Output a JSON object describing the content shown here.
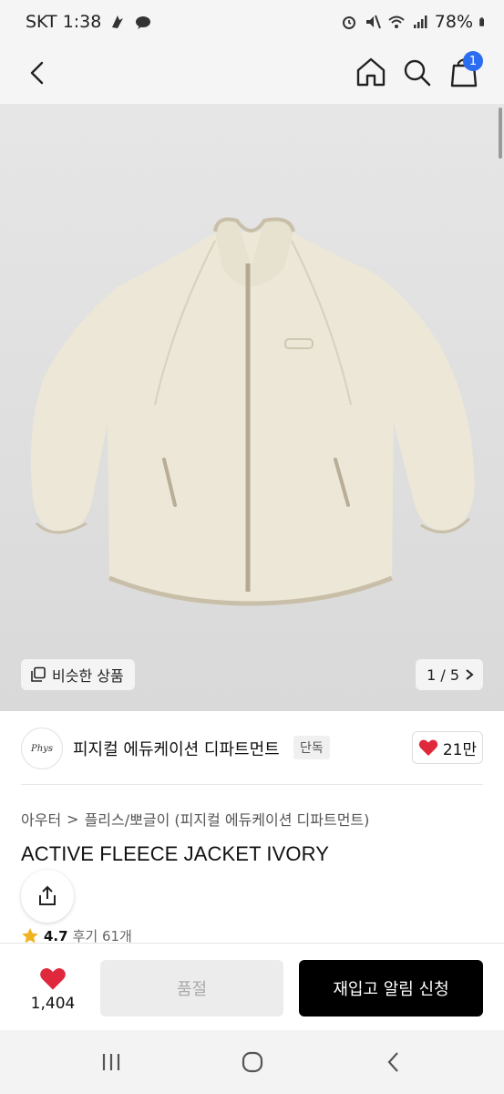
{
  "status_bar": {
    "carrier_time": "SKT 1:38",
    "battery": "78%"
  },
  "nav": {
    "cart_count": "1"
  },
  "image": {
    "similar_label": "비슷한 상품",
    "pager": "1 / 5"
  },
  "brand": {
    "logo_text": "Phys",
    "name": "피지컬 에듀케이션 디파트먼트",
    "tag": "단독",
    "likes": "21만"
  },
  "product": {
    "breadcrumb_1": "아우터",
    "breadcrumb_sep": ">",
    "breadcrumb_2": "플리스/뽀글이 (피지컬 에듀케이션 디파트먼트)",
    "title": "ACTIVE FLEECE JACKET IVORY",
    "rating": "4.7",
    "reviews": "후기 61개"
  },
  "actions": {
    "wish_count": "1,404",
    "soldout_label": "품절",
    "restock_label": "재입고 알림 신청"
  },
  "colors": {
    "accent_badge": "#2b6cf0",
    "heart": "#e0283c",
    "star": "#f0b21f",
    "jacket": "#ece7d6",
    "trim": "#c9bfa9"
  },
  "icons": [
    "back-icon",
    "home-icon",
    "search-icon",
    "cart-icon",
    "similar-icon",
    "chevron-right-icon",
    "heart-icon",
    "share-icon",
    "star-icon",
    "recents-icon",
    "home-circle-icon",
    "back-nav-icon"
  ]
}
